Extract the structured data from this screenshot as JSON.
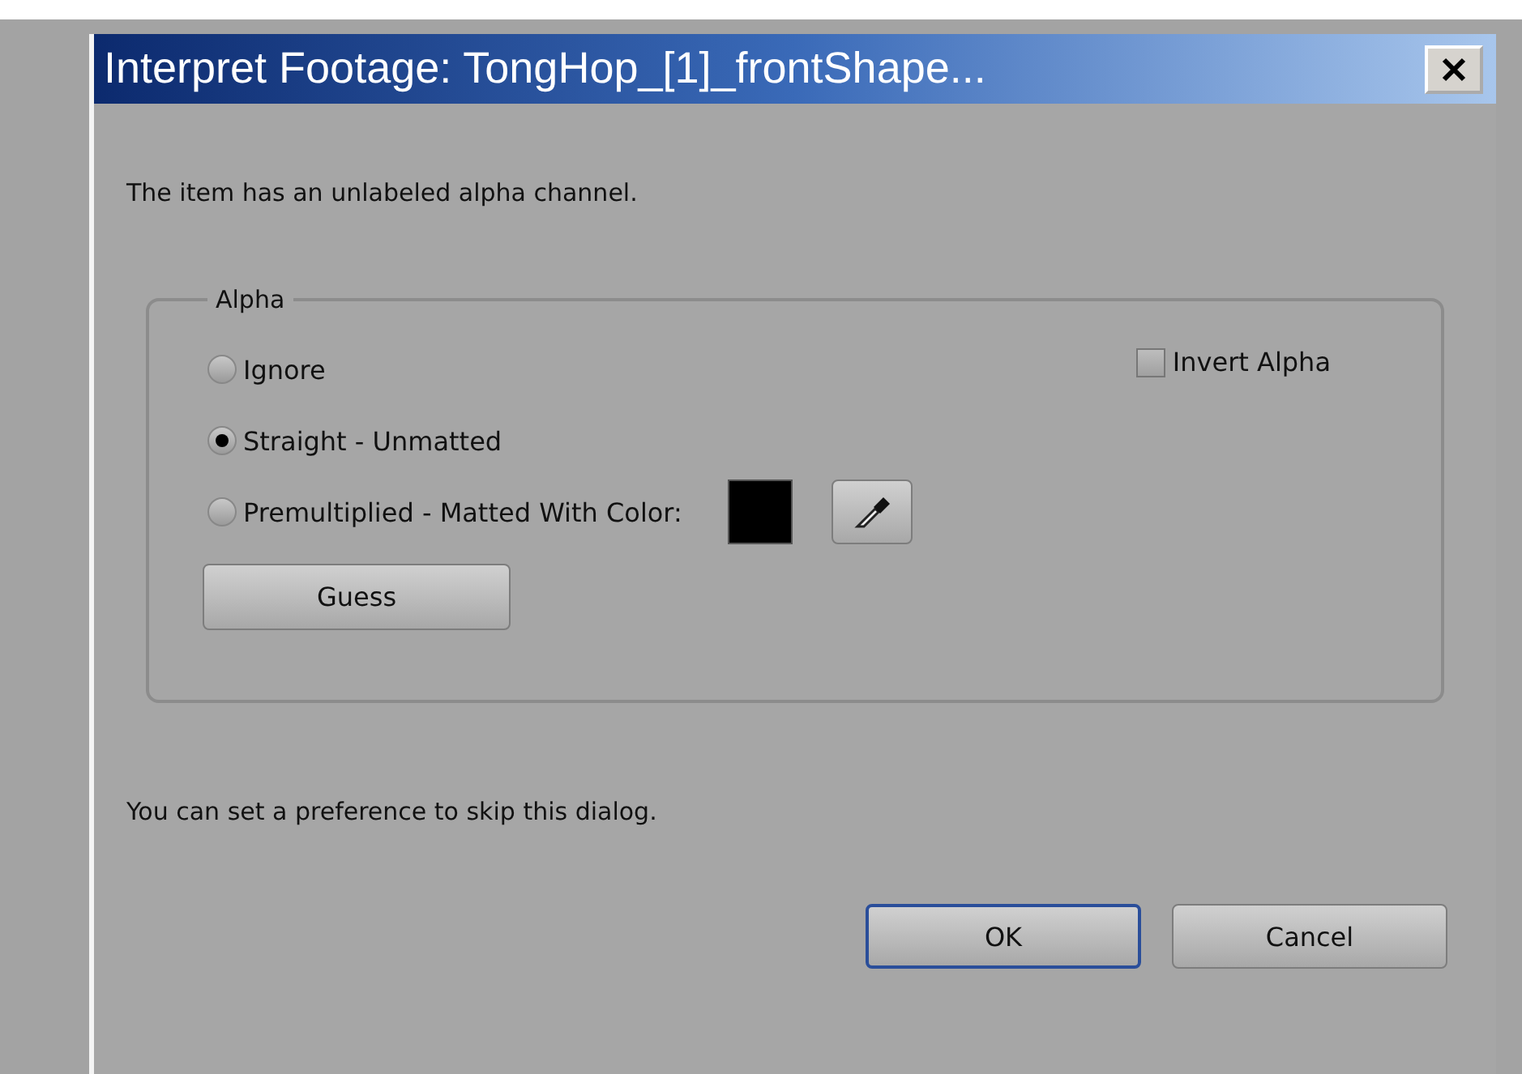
{
  "window": {
    "title": "Interpret Footage: TongHop_[1]_frontShape..."
  },
  "message": "The item has an unlabeled alpha channel.",
  "alpha_group": {
    "title": "Alpha",
    "options": [
      {
        "label": "Ignore",
        "selected": false
      },
      {
        "label": "Straight - Unmatted",
        "selected": true
      },
      {
        "label": "Premultiplied - Matted With Color:",
        "selected": false
      }
    ],
    "invert": {
      "label": "Invert Alpha",
      "checked": false
    },
    "guess_button": "Guess"
  },
  "footer_note": "You can set a preference to skip this dialog.",
  "buttons": [
    {
      "label": "OK",
      "default": true
    },
    {
      "label": "Cancel",
      "default": false
    }
  ]
}
